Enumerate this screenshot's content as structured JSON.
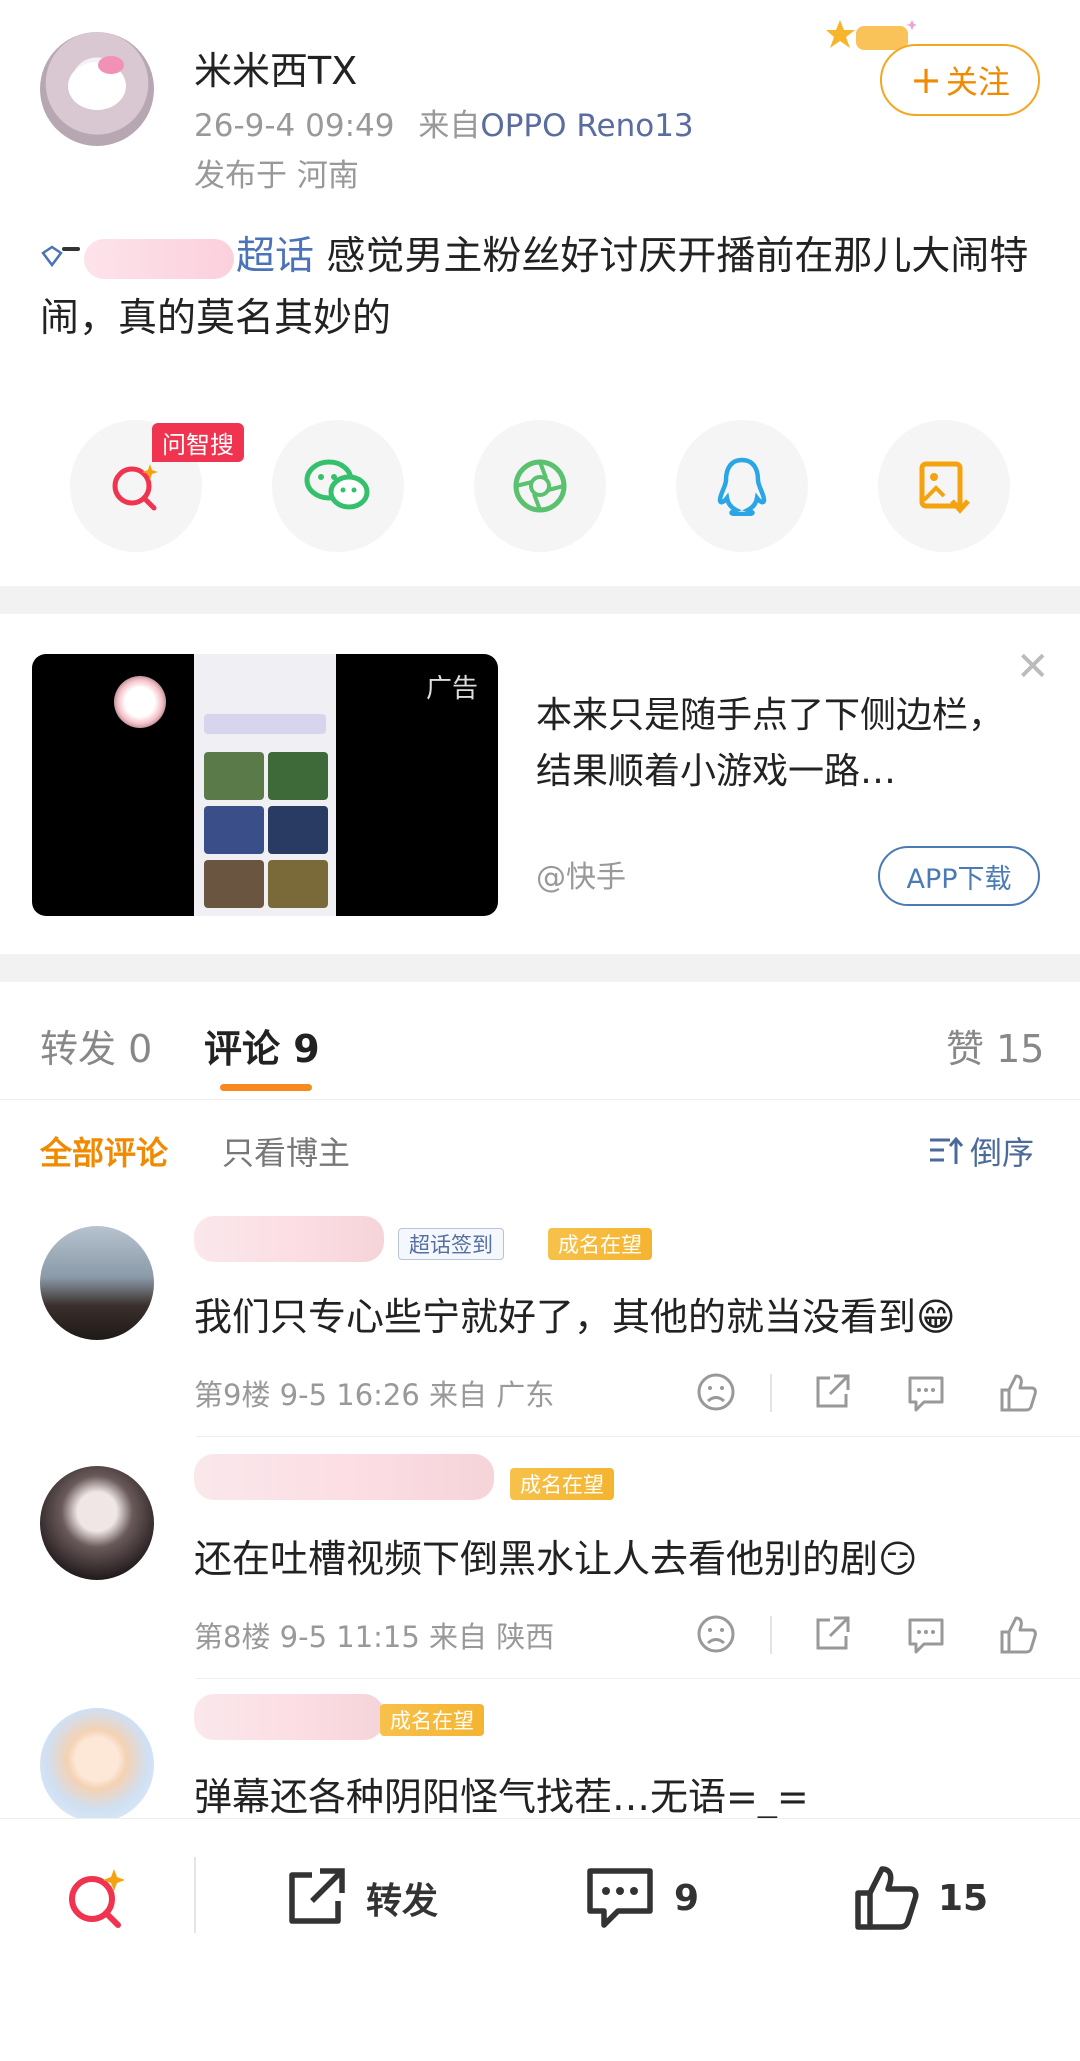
{
  "post": {
    "username": "米米西TX",
    "time": "26-9-4 09:49",
    "from_label": "来自",
    "device": "OPPO Reno13",
    "location": "发布于 河南",
    "follow_label": "关注",
    "topic_suffix": "超话",
    "text": " 感觉男主粉丝好讨厌开播前在那儿大闹特闹，真的莫名其妙的"
  },
  "share": {
    "badge": "问智搜",
    "items": [
      "zhisou-icon",
      "wechat-icon",
      "moments-icon",
      "qq-icon",
      "save-image-icon"
    ],
    "colors": {
      "zhisou": "#f0344f",
      "wechat": "#35c06d",
      "moments": "#5ac16f",
      "qq": "#2aa5e6",
      "save": "#f5a20f"
    }
  },
  "ad": {
    "tag": "广告",
    "title": "本来只是随手点了下侧边栏，结果顺着小游戏一路…",
    "source": "@快手",
    "button": "APP下载"
  },
  "tabs": {
    "repost": "转发 0",
    "comments": "评论 9",
    "likes": "赞 15"
  },
  "filters": {
    "all": "全部评论",
    "poster_only": "只看博主",
    "sort": "倒序"
  },
  "comments": [
    {
      "badges": [
        "超话签到",
        "成名在望"
      ],
      "text": "我们只专心些宁就好了，其他的就当没看到",
      "emoji": "😁",
      "meta": "第9楼 9-5 16:26 来自 广东"
    },
    {
      "badges": [
        "成名在望"
      ],
      "text": "还在吐槽视频下倒黑水让人去看他别的剧",
      "emoji": "😏",
      "meta": "第8楼 9-5 11:15 来自 陕西"
    },
    {
      "badges": [
        "成名在望"
      ],
      "text": "弹幕还各种阴阳怪气找茬…无语=_=",
      "emoji": "",
      "meta": ""
    }
  ],
  "bottom": {
    "repost": "转发",
    "comments": "9",
    "likes": "15"
  },
  "accent": "#f08a00"
}
